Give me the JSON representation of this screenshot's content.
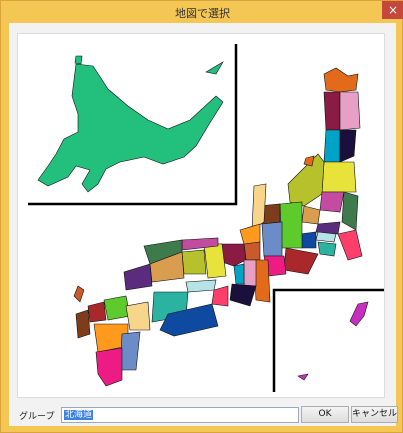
{
  "window": {
    "title": "地図で選択",
    "close_symbol": "×"
  },
  "map": {
    "region_colors": [
      "#23c07d",
      "#e36a1b",
      "#8a1b43",
      "#e6a0c6",
      "#00a3c8",
      "#1b0f3c",
      "#e8e33a",
      "#b7c12b",
      "#c44ca0",
      "#3d7a4c",
      "#d99d4f",
      "#5b2c7e",
      "#b7e3e6",
      "#ff3f6b",
      "#2ab3a1",
      "#0d4aa0",
      "#5ecb2c",
      "#a8282c",
      "#7d3c1c",
      "#f7d58a",
      "#ff9a1f",
      "#6c8cc8",
      "#ec1c84",
      "#c85a2b"
    ],
    "inset_okinawa_color": "#c62fc0"
  },
  "footer": {
    "group_label": "グループ",
    "group_value": "北海道",
    "ok_label": "OK",
    "cancel_label": "キャンセル"
  }
}
